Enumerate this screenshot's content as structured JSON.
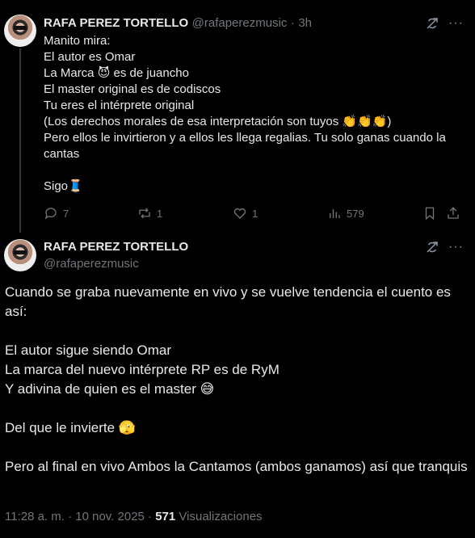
{
  "tweet1": {
    "author_name": "RAFA PEREZ TORTELLO",
    "handle": "@rafaperezmusic",
    "separator": "·",
    "time": "3h",
    "text": "Manito mira:\nEl autor es Omar\nLa Marca 😈 es de juancho\nEl master original es de codiscos\nTu eres el intérprete original\n(Los derechos morales de esa interpretación son tuyos 👏👏👏)\nPero ellos le invirtieron y a ellos les llega regalias. Tu solo ganas cuando la cantas\n\nSigo🧵",
    "replies": "7",
    "reposts": "1",
    "likes": "1",
    "views": "579"
  },
  "tweet2": {
    "author_name": "RAFA PEREZ TORTELLO",
    "handle": "@rafaperezmusic",
    "text": "Cuando se graba nuevamente en vivo y se vuelve tendencia el cuento es así:\n\nEl autor sigue siendo Omar\nLa marca del nuevo intérprete RP es de RyM\nY adivina de quien es el master 😅\n\nDel que le invierte 🫣\n\nPero al final en vivo Ambos la Cantamos (ambos ganamos) así que tranquis",
    "timestamp": "11:28 a. m. · 10 nov. 2025 · ",
    "views_count": "571",
    "views_label": " Visualizaciones"
  },
  "icons": {
    "grok": "grok-icon",
    "more": "more-icon",
    "reply": "reply-icon",
    "repost": "repost-icon",
    "like": "like-icon",
    "views": "views-icon",
    "bookmark": "bookmark-icon",
    "share": "share-icon"
  }
}
